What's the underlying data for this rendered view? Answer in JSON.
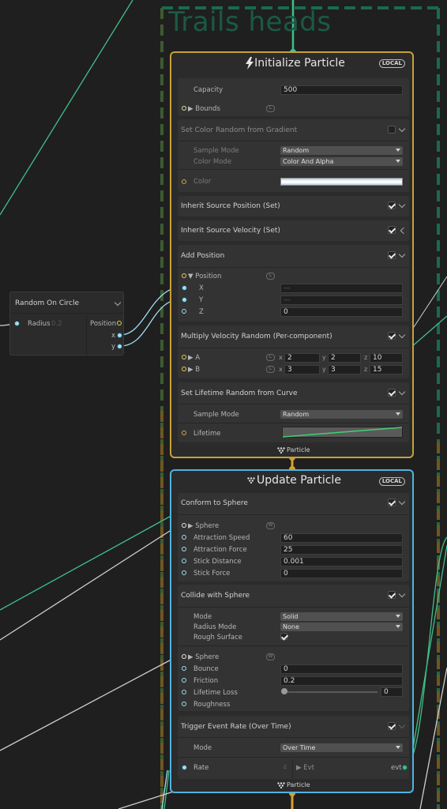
{
  "group": {
    "title": "Trails heads"
  },
  "node": {
    "title": "Random On Circle",
    "radius_label": "Radius",
    "radius_value": "0.2",
    "position_label": "Position",
    "x_label": "x",
    "y_label": "y"
  },
  "init": {
    "title": "Initialize Particle",
    "badge": "LOCAL",
    "capacity_label": "Capacity",
    "capacity_value": "500",
    "bounds_label": "Bounds",
    "gradient": {
      "title": "Set Color Random from Gradient",
      "sample_mode_label": "Sample Mode",
      "sample_mode_value": "Random",
      "color_mode_label": "Color Mode",
      "color_mode_value": "Color And Alpha",
      "color_label": "Color"
    },
    "inherit_pos": {
      "title": "Inherit Source Position (Set)"
    },
    "inherit_vel": {
      "title": "Inherit Source Velocity (Set)"
    },
    "add_position": {
      "title": "Add Position",
      "position_label": "Position",
      "x_label": "X",
      "y_label": "Y",
      "z_label": "Z",
      "x_value": "—",
      "y_value": "—",
      "z_value": "0"
    },
    "mult_vel": {
      "title": "Multiply Velocity Random (Per-component)",
      "a_label": "A",
      "b_label": "B",
      "a": [
        "2",
        "2",
        "10"
      ],
      "b": [
        "3",
        "3",
        "15"
      ],
      "x": "x",
      "y": "y",
      "z": "z"
    },
    "lifetime": {
      "title": "Set Lifetime Random from Curve",
      "sample_mode_label": "Sample Mode",
      "sample_mode_value": "Random",
      "lifetime_label": "Lifetime"
    },
    "flow_out": "Particle"
  },
  "update": {
    "title": "Update Particle",
    "badge": "LOCAL",
    "conform": {
      "title": "Conform to Sphere",
      "sphere_label": "Sphere",
      "speed_label": "Attraction Speed",
      "speed_value": "60",
      "force_label": "Attraction Force",
      "force_value": "25",
      "stick_dist_label": "Stick Distance",
      "stick_dist_value": "0.001",
      "stick_force_label": "Stick Force",
      "stick_force_value": "0"
    },
    "collide": {
      "title": "Collide with Sphere",
      "mode_label": "Mode",
      "mode_value": "Solid",
      "radius_mode_label": "Radius Mode",
      "radius_mode_value": "None",
      "rough_label": "Rough Surface",
      "sphere_label": "Sphere",
      "bounce_label": "Bounce",
      "bounce_value": "0",
      "friction_label": "Friction",
      "friction_value": "0.2",
      "lifetime_loss_label": "Lifetime Loss",
      "lifetime_loss_value": "0",
      "lifetime_loss_level": 0.0,
      "roughness_label": "Roughness"
    },
    "trigger": {
      "title": "Trigger Event Rate (Over Time)",
      "mode_label": "Mode",
      "mode_value": "Over Time",
      "rate_label": "Rate",
      "rate_value": "4",
      "evt_label": "Evt",
      "evt_out": "evt"
    },
    "flow_out": "Particle"
  },
  "colors": {
    "init_border": "#c6a13a",
    "update_border": "#4fb3e0",
    "group": "#1a5a45",
    "wire_green": "#3fc08a",
    "wire_cyan": "#9ee0f4",
    "wire_orange": "#d4a030"
  }
}
